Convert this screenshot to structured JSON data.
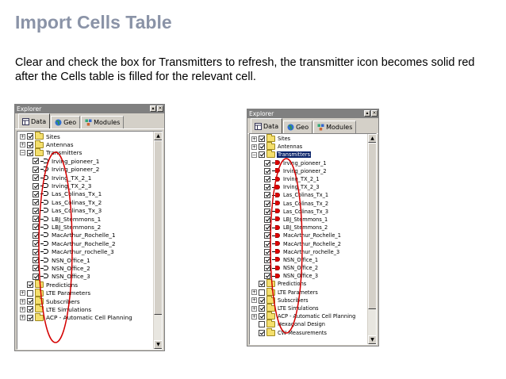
{
  "slide": {
    "title": "Import Cells Table",
    "body": "Clear and check the box for Transmitters to refresh, the transmitter icon becomes solid red after the Cells table is filled for the relevant cell."
  },
  "colors": {
    "title": "#8a93a7",
    "annotation": "#d40000",
    "selection": "#0a246a",
    "tx_solid": "#e00000"
  },
  "left_explorer": {
    "title": "Explorer",
    "tabs": [
      {
        "label": "Data",
        "icon": "data-table-icon",
        "active": true
      },
      {
        "label": "Geo",
        "icon": "globe-icon",
        "active": false
      },
      {
        "label": "Modules",
        "icon": "modules-icon",
        "active": false
      }
    ],
    "tree": [
      {
        "label": "Sites",
        "level": 0,
        "expander": "+",
        "checked": true,
        "icon": "folder"
      },
      {
        "label": "Antennas",
        "level": 0,
        "expander": "+",
        "checked": true,
        "icon": "folder"
      },
      {
        "label": "Transmitters",
        "level": 0,
        "expander": "-",
        "checked": true,
        "icon": "folder"
      },
      {
        "label": "Irving_pioneer_1",
        "level": 1,
        "checked": true,
        "icon": "tx"
      },
      {
        "label": "Irving_pioneer_2",
        "level": 1,
        "checked": true,
        "icon": "tx"
      },
      {
        "label": "Irving_TX_2_1",
        "level": 1,
        "checked": true,
        "icon": "tx"
      },
      {
        "label": "Irving_TX_2_3",
        "level": 1,
        "checked": true,
        "icon": "tx"
      },
      {
        "label": "Las_Colinas_Tx_1",
        "level": 1,
        "checked": true,
        "icon": "tx"
      },
      {
        "label": "Las_Colinas_Tx_2",
        "level": 1,
        "checked": true,
        "icon": "tx"
      },
      {
        "label": "Las_Colinas_Tx_3",
        "level": 1,
        "checked": true,
        "icon": "tx"
      },
      {
        "label": "LBJ_Stemmons_1",
        "level": 1,
        "checked": true,
        "icon": "tx"
      },
      {
        "label": "LBJ_Stemmons_2",
        "level": 1,
        "checked": true,
        "icon": "tx"
      },
      {
        "label": "MacArthur_Rochelle_1",
        "level": 1,
        "checked": true,
        "icon": "tx"
      },
      {
        "label": "MacArthur_Rochelle_2",
        "level": 1,
        "checked": true,
        "icon": "tx"
      },
      {
        "label": "MacArthur_rochelle_3",
        "level": 1,
        "checked": true,
        "icon": "tx"
      },
      {
        "label": "NSN_Office_1",
        "level": 1,
        "checked": true,
        "icon": "tx"
      },
      {
        "label": "NSN_Office_2",
        "level": 1,
        "checked": true,
        "icon": "tx"
      },
      {
        "label": "NSN_Office_3",
        "level": 1,
        "checked": true,
        "icon": "tx"
      },
      {
        "label": "Predictions",
        "level": 0,
        "expander": "",
        "checked": true,
        "icon": "folder"
      },
      {
        "label": "LTE Parameters",
        "level": 0,
        "expander": "+",
        "checked": false,
        "icon": "folder"
      },
      {
        "label": "Subscribers",
        "level": 0,
        "expander": "+",
        "checked": true,
        "icon": "folder"
      },
      {
        "label": "LTE Simulations",
        "level": 0,
        "expander": "+",
        "checked": true,
        "icon": "folder"
      },
      {
        "label": "ACP - Automatic Cell Planning",
        "level": 0,
        "expander": "+",
        "checked": true,
        "icon": "folder"
      }
    ]
  },
  "right_explorer": {
    "title": "Explorer",
    "tabs": [
      {
        "label": "Data",
        "icon": "data-table-icon",
        "active": true
      },
      {
        "label": "Geo",
        "icon": "globe-icon",
        "active": false
      },
      {
        "label": "Modules",
        "icon": "modules-icon",
        "active": false
      }
    ],
    "tree": [
      {
        "label": "Sites",
        "level": 0,
        "expander": "+",
        "checked": true,
        "icon": "folder"
      },
      {
        "label": "Antennas",
        "level": 0,
        "expander": "+",
        "checked": true,
        "icon": "folder"
      },
      {
        "label": "Transmitters",
        "level": 0,
        "expander": "-",
        "checked": true,
        "icon": "folder",
        "selected": true
      },
      {
        "label": "Irving_pioneer_1",
        "level": 1,
        "checked": true,
        "icon": "tx-solid"
      },
      {
        "label": "Irving_pioneer_2",
        "level": 1,
        "checked": true,
        "icon": "tx-solid"
      },
      {
        "label": "Irving_TX_2_1",
        "level": 1,
        "checked": true,
        "icon": "tx-solid"
      },
      {
        "label": "Irving_TX_2_3",
        "level": 1,
        "checked": true,
        "icon": "tx-solid"
      },
      {
        "label": "Las_Colinas_Tx_1",
        "level": 1,
        "checked": true,
        "icon": "tx-solid"
      },
      {
        "label": "Las_Colinas_Tx_2",
        "level": 1,
        "checked": true,
        "icon": "tx-solid"
      },
      {
        "label": "Las_Colinas_Tx_3",
        "level": 1,
        "checked": true,
        "icon": "tx-solid"
      },
      {
        "label": "LBJ_Stemmons_1",
        "level": 1,
        "checked": true,
        "icon": "tx-solid"
      },
      {
        "label": "LBJ_Stemmons_2",
        "level": 1,
        "checked": true,
        "icon": "tx-solid"
      },
      {
        "label": "MacArthur_Rochelle_1",
        "level": 1,
        "checked": true,
        "icon": "tx-solid"
      },
      {
        "label": "MacArthur_Rochelle_2",
        "level": 1,
        "checked": true,
        "icon": "tx-solid"
      },
      {
        "label": "MacArthur_rochelle_3",
        "level": 1,
        "checked": true,
        "icon": "tx-solid"
      },
      {
        "label": "NSN_Office_1",
        "level": 1,
        "checked": true,
        "icon": "tx-solid"
      },
      {
        "label": "NSN_Office_2",
        "level": 1,
        "checked": true,
        "icon": "tx-solid"
      },
      {
        "label": "NSN_Office_3",
        "level": 1,
        "checked": true,
        "icon": "tx-solid"
      },
      {
        "label": "Predictions",
        "level": 0,
        "expander": "",
        "checked": true,
        "icon": "folder"
      },
      {
        "label": "LTE Parameters",
        "level": 0,
        "expander": "+",
        "checked": false,
        "icon": "folder"
      },
      {
        "label": "Subscribers",
        "level": 0,
        "expander": "+",
        "checked": true,
        "icon": "folder"
      },
      {
        "label": "LTE Simulations",
        "level": 0,
        "expander": "+",
        "checked": true,
        "icon": "folder"
      },
      {
        "label": "ACP - Automatic Cell Planning",
        "level": 0,
        "expander": "+",
        "checked": true,
        "icon": "folder"
      },
      {
        "label": "Hexagonal Design",
        "level": 0,
        "expander": "",
        "checked": false,
        "icon": "folder"
      },
      {
        "label": "CW Measurements",
        "level": 0,
        "expander": "",
        "checked": true,
        "icon": "folder"
      }
    ]
  }
}
